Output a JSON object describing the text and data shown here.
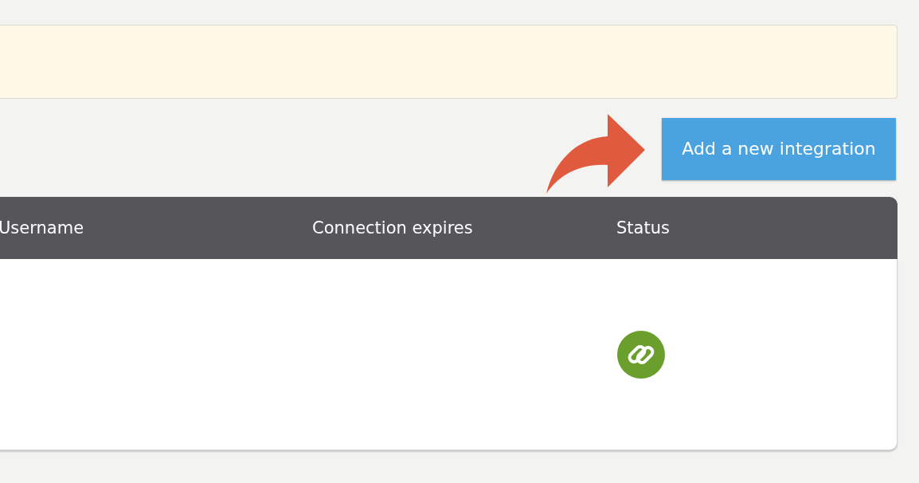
{
  "notice_banner": {
    "kind": "warning"
  },
  "add_button": {
    "label": "Add a new integration"
  },
  "table": {
    "columns": [
      "Username",
      "Connection expires",
      "Status"
    ],
    "rows": [
      {
        "connected": true
      }
    ]
  }
}
